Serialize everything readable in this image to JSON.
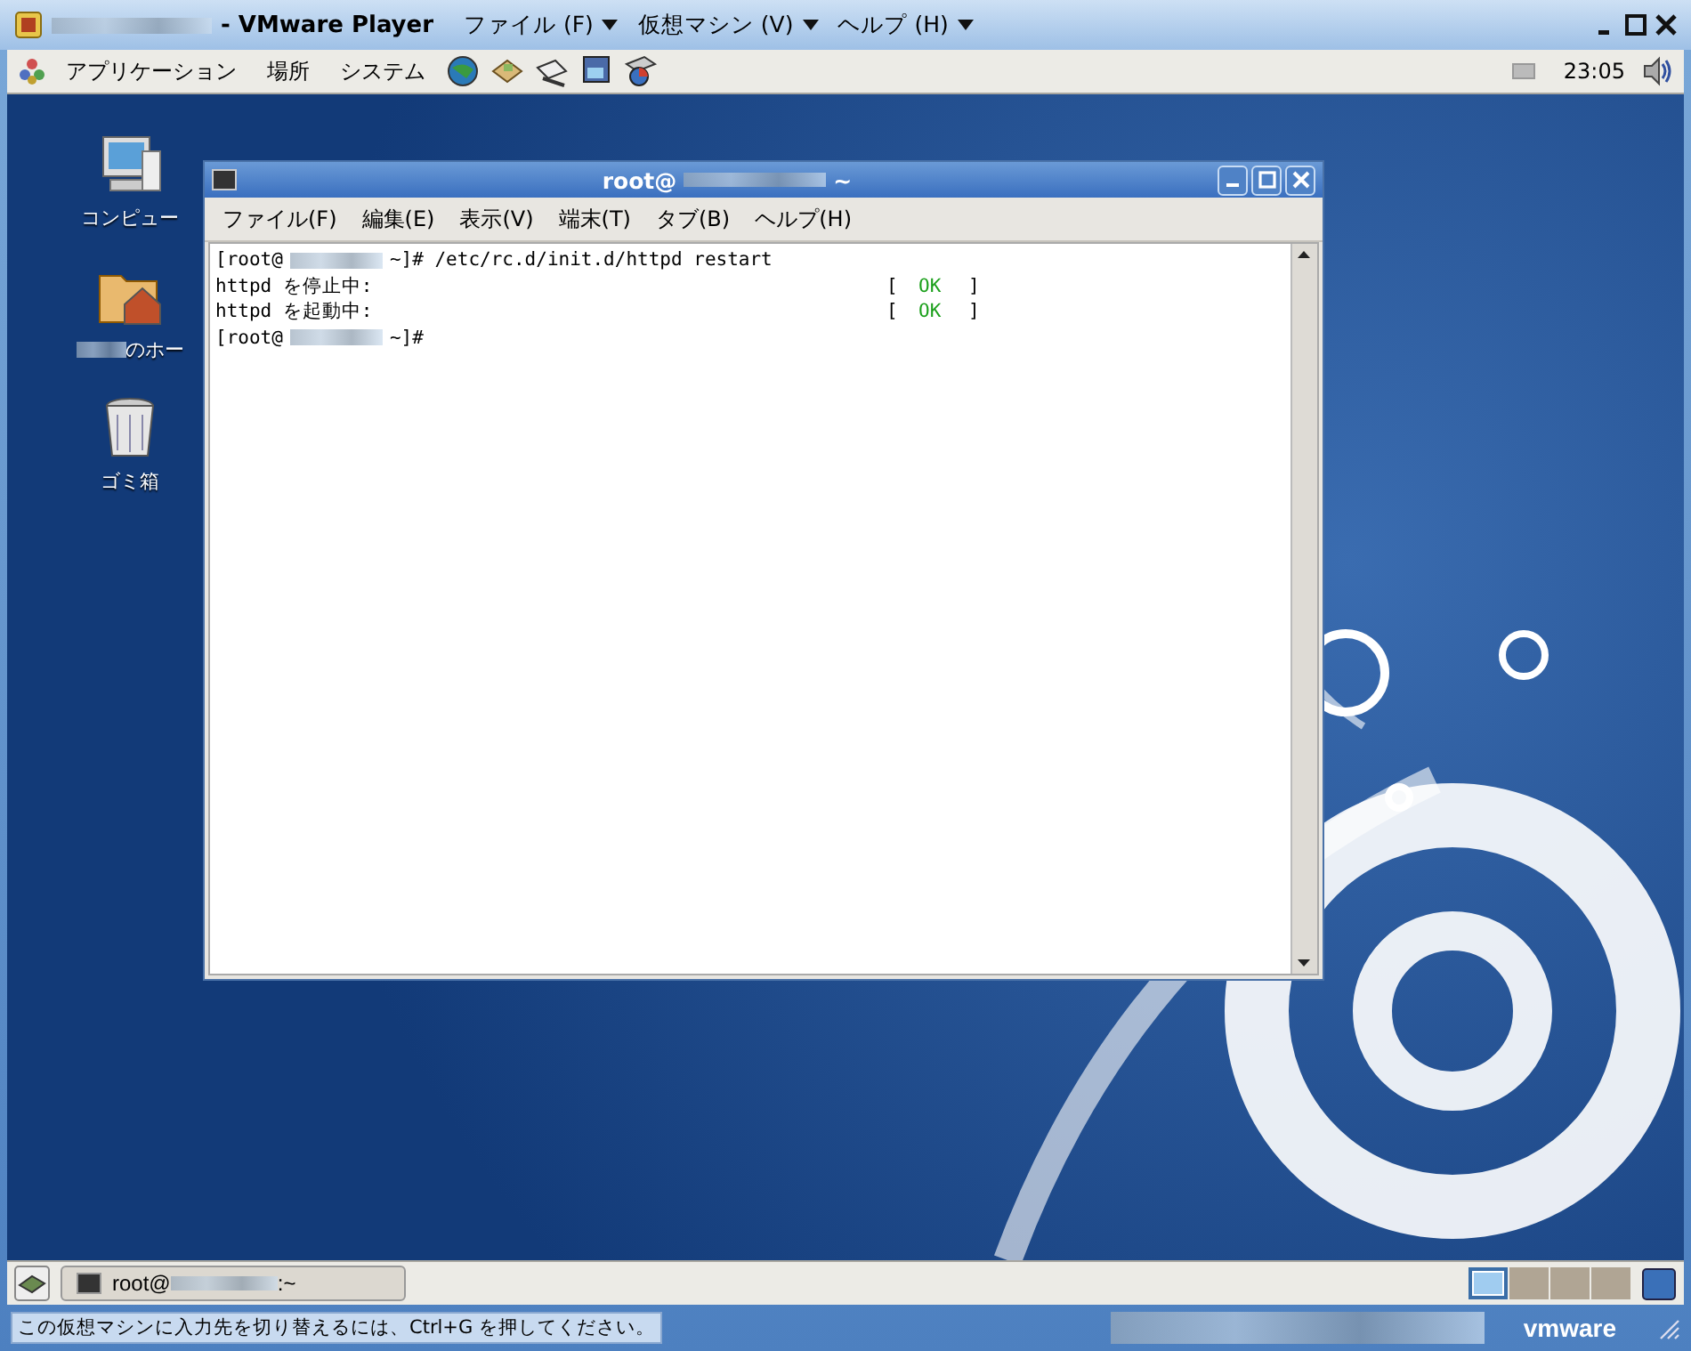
{
  "window": {
    "title": "- VMware Player",
    "menus": [
      {
        "label": "ファイル (F)"
      },
      {
        "label": "仮想マシン (V)"
      },
      {
        "label": "ヘルプ (H)"
      }
    ]
  },
  "top_panel": {
    "menus": [
      "アプリケーション",
      "場所",
      "システム"
    ],
    "clock": "23:05"
  },
  "desktop_icons": [
    {
      "kind": "computer",
      "label": "コンピュー"
    },
    {
      "kind": "home",
      "label": "のホー"
    },
    {
      "kind": "trash",
      "label": "ゴミ箱"
    }
  ],
  "terminal": {
    "title_prefix": "root@",
    "title_suffix": "~",
    "menus": [
      "ファイル(F)",
      "編集(E)",
      "表示(V)",
      "端末(T)",
      "タブ(B)",
      "ヘルプ(H)"
    ],
    "lines": [
      {
        "kind": "prompt",
        "before": "[root@",
        "after": "~]# /etc/rc.d/init.d/httpd restart"
      },
      {
        "kind": "status",
        "text": "httpd を停止中:",
        "open": "[",
        "status": "OK",
        "close": "]"
      },
      {
        "kind": "status",
        "text": "httpd を起動中:",
        "open": "[",
        "status": "OK",
        "close": "]"
      },
      {
        "kind": "prompt",
        "before": "[root@",
        "after": "~]#"
      }
    ]
  },
  "bottom_panel": {
    "task": {
      "prefix": "root@",
      "suffix": ":~"
    },
    "workspaces": [
      {
        "selected": true
      },
      {
        "selected": false
      },
      {
        "selected": false
      },
      {
        "selected": false
      }
    ]
  },
  "status_bar": {
    "hint": "この仮想マシンに入力先を切り替えるには、Ctrl+G を押してください。",
    "logo": "vmware"
  }
}
